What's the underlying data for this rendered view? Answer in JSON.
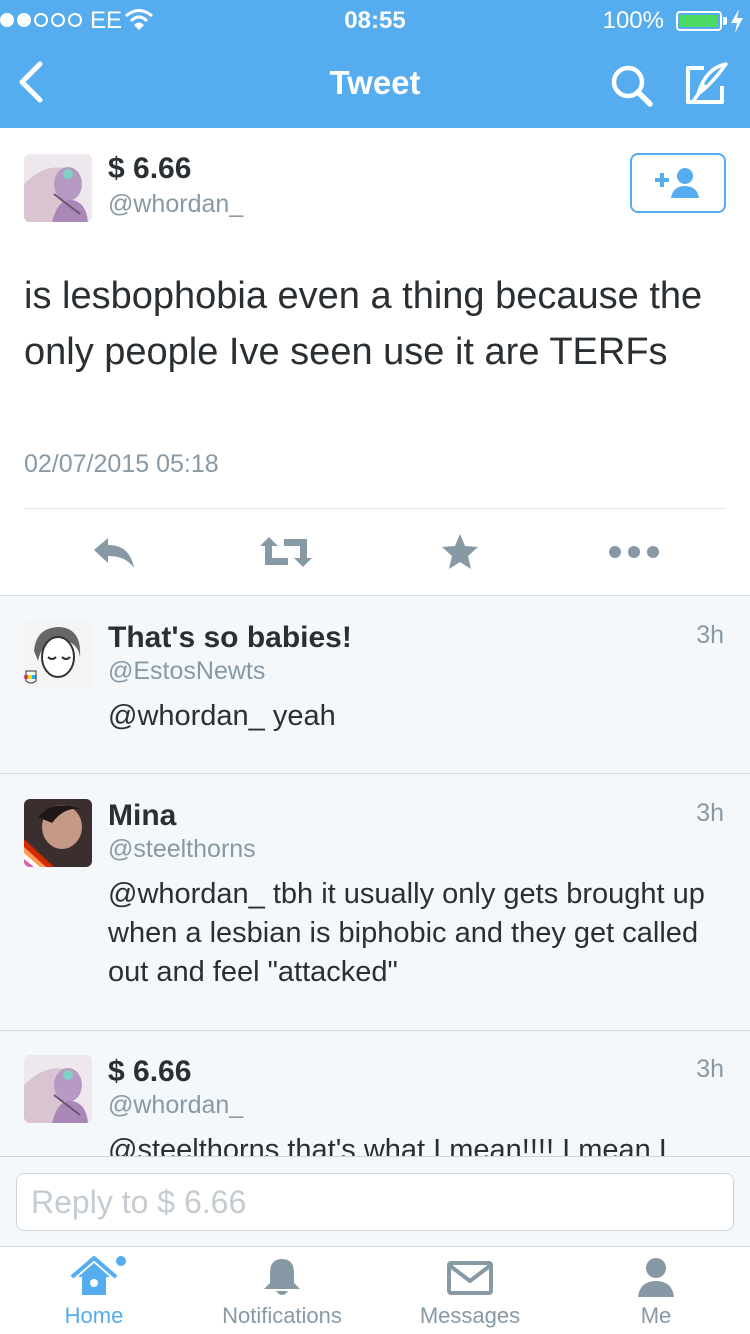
{
  "status_bar": {
    "carrier": "EE",
    "time": "08:55",
    "battery": "100%"
  },
  "nav": {
    "title": "Tweet",
    "icons": [
      "back-chevron-icon",
      "search-icon",
      "compose-icon"
    ]
  },
  "tweet": {
    "name": "$ 6.66",
    "handle": "@whordan_",
    "text": "is lesbophobia even a thing because the only people Ive seen use it are TERFs",
    "timestamp": "02/07/2015 05:18",
    "actions": [
      "reply-icon",
      "retweet-icon",
      "favorite-icon",
      "more-icon"
    ]
  },
  "replies": [
    {
      "name": "That's so babies!",
      "handle": "@EstosNewts",
      "time": "3h",
      "text": "@whordan_ yeah"
    },
    {
      "name": "Mina",
      "handle": "@steelthorns",
      "time": "3h",
      "text": "@whordan_ tbh it usually only gets brought up when a lesbian is biphobic and they get called out and feel \"attacked\""
    },
    {
      "name": "$ 6.66",
      "handle": "@whordan_",
      "time": "3h",
      "text": "@steelthorns that's what I mean!!!! I mean I"
    }
  ],
  "reply_box": {
    "placeholder": "Reply to $ 6.66"
  },
  "tabs": [
    {
      "label": "Home",
      "icon": "home-icon",
      "active": true
    },
    {
      "label": "Notifications",
      "icon": "bell-icon",
      "active": false
    },
    {
      "label": "Messages",
      "icon": "envelope-icon",
      "active": false
    },
    {
      "label": "Me",
      "icon": "person-icon",
      "active": false
    }
  ],
  "colors": {
    "brand": "#55acee",
    "text": "#292f33",
    "muted": "#8899a6",
    "battery": "#4cd964"
  }
}
